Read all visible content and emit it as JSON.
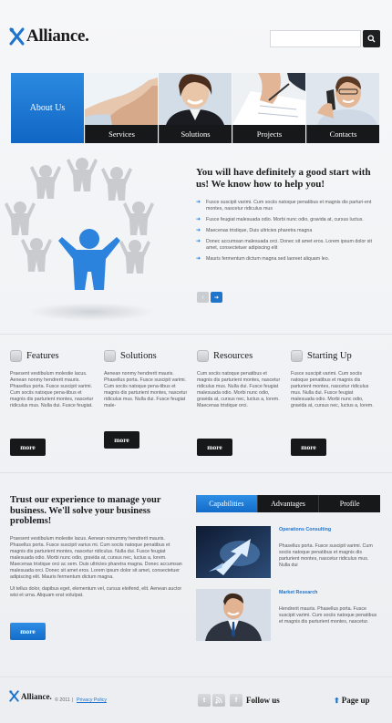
{
  "header": {
    "logo_text": "Alliance.",
    "search_placeholder": ""
  },
  "nav": {
    "about_label": "About Us",
    "items": [
      {
        "label": "Services"
      },
      {
        "label": "Solutions"
      },
      {
        "label": "Projects"
      },
      {
        "label": "Contacts"
      }
    ]
  },
  "hero": {
    "title": "You will have definitely a good start with us! We know how to help you!",
    "bullets": [
      "Fusce suscipit varimi. Cum sociis natoque penatibus et magnis dis parturi-ent montes, nascetur ridiculus mus",
      "Fusce feugiat malesuada odio. Morbi nunc odio, gravida at, cursus luctus.",
      "Maecenas tristique, Duis ultricies pharetra magna",
      "Donec accumsan malesuada orci. Donec sit amet eros. Lorem ipsum dolor sit amet, consectetuer adipiscing elit",
      "Mauris fermentum dictum magna sed laoreet aliquam leo."
    ],
    "pager_prev": "‹",
    "pager_next": "➔"
  },
  "features": [
    {
      "title": "Features",
      "text": "Praesent vestibulum molestie lacus. Aenean nonmy hendrerit mauris. Phasellus porta. Fusce suscipit varimi. Cum sociis natoque pena-tibus et magnis dis parturient montes, nascetur ridiculus mus. Nulla dui. Fusce feugiat.",
      "button": "more"
    },
    {
      "title": "Solutions",
      "text": "Aenean nonmy hendrerit mauris. Phasellus porta. Fusce suscipit varimi. Cum sociis natoque pena-tibus et magnis dis parturient montes, nascetur ridiculus mus. Nulla dui. Fusce feugiat male-",
      "button": "more"
    },
    {
      "title": "Resources",
      "text": "Cum sociis natoque penatibus et magnis dis parturient montes, nascetur ridiculus mus. Nulla dui. Fusce feugiat malesuada odio. Morbi nunc odio, gravida at, cursus nec, luctus a, lorem. Maecenas tristique orci.",
      "button": "more"
    },
    {
      "title": "Starting Up",
      "text": "Fusce suscipit varimi. Cum sociis natoque penatibus et magnis dis parturient montes, nascetur ridiculus mus. Nulla dui. Fusce feugiat malesuada odio. Morbi nunc odio, gravida at, cursus nec, luctus a, lorem.",
      "button": "more"
    }
  ],
  "trust": {
    "title": "Trust our experience to manage your business. We'll solve your business problems!",
    "p1": "Praesent vestibulum molestie lacus. Aenean nonummy hendrerit mauris. Phasellus porta. Fusce suscipit varius mi. Cum sociis natoque penatibus et magnis dis parturient montes, nascetur ridiculus. Nulla dui. Fusce feugiat malesuada odio. Morbi nunc odio, gravida at, cursus nec, luctus a, lorem. Maecenas tristique orci ac sem. Duis ultricies pharetra magna. Donec accumsan malesuada orci. Donec sit amet eros. Lorem ipsum dolor sit amet, consectetuer adipiscing elit. Mauris fermentum dictum magna.",
    "p2": "Ut tellus dolor, dapibus eget, elementum vel, cursus eleifend, elit. Aenean auctor wisi et urna. Aliquam erat volutpat.",
    "button": "more"
  },
  "tabs": [
    {
      "label": "Capabilities"
    },
    {
      "label": "Advantages"
    },
    {
      "label": "Profile"
    }
  ],
  "posts": [
    {
      "title": "Operations Consulting",
      "text": "Phasellus porta. Fusce suscipit varimi. Cum sociis natoque penatibus et magnis dis parturient montes, nascetur ridiculus mus. Nulla dui"
    },
    {
      "title": "Market Research",
      "text": "Hendrerit mauris. Phasellus porta. Fusce suscipit varimi. Cum sociis natoque penatibus et magnis dis parturient montes, nascetur."
    }
  ],
  "footer": {
    "logo_text": "Alliance.",
    "copyright": "© 2011",
    "separator": "|",
    "policy": "Privacy Policy",
    "follow": "Follow us",
    "page_up": "Page up",
    "social": [
      "t",
      "rss",
      "f"
    ]
  },
  "colors": {
    "accent": "#1f74cc",
    "dark": "#17181a"
  }
}
